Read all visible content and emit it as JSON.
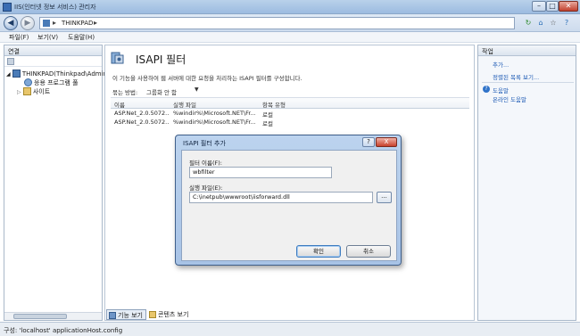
{
  "window": {
    "title": "IIS(인터넷 정보 서비스) 관리자"
  },
  "address": {
    "crumb": "THINKPAD",
    "sep1": "▸",
    "sep2": "▸"
  },
  "menu": {
    "file": "파일(F)",
    "view": "보기(V)",
    "help": "도움말(H)"
  },
  "connections": {
    "header": "연결",
    "tree": [
      {
        "label": "THINKPAD(Thinkpad\\Admin"
      },
      {
        "label": "응용 프로그램 풀"
      },
      {
        "label": "사이트"
      }
    ]
  },
  "main": {
    "title": "ISAPI 필터",
    "description": "이 기능을 사용하여 웹 서버에 대한 요청을 처리하는 ISAPI 필터를 구성합니다.",
    "group_by_label": "묶는 방법:",
    "group_by_value": "그룹화 안 함",
    "columns": [
      "이름",
      "실행 파일",
      "항목 유형"
    ],
    "rows": [
      [
        "ASP.Net_2.0.5072...",
        "%windir%\\Microsoft.NET\\Fr...",
        "로컬"
      ],
      [
        "ASP.Net_2.0.5072...",
        "%windir%\\Microsoft.NET\\Fr...",
        "로컬"
      ]
    ]
  },
  "bottom_tabs": {
    "features": "기능 보기",
    "content": "콘텐츠 보기"
  },
  "actions": {
    "header": "작업",
    "add": "추가...",
    "sort": "정렬된 목록 보기...",
    "help": "도움말",
    "online_help": "온라인 도움말"
  },
  "status": {
    "text": "구성: 'localhost' applicationHost.config"
  },
  "dialog": {
    "title": "ISAPI 필터 추가",
    "help_button": "?",
    "close_button": "X",
    "filter_name_label": "필터 이름(F):",
    "filter_name_value": "wbfilter",
    "executable_label": "실행 파일(E):",
    "executable_value": "C:\\inetpub\\wwwroot\\iisforward.dll",
    "browse_button": "...",
    "ok_button": "확인",
    "cancel_button": "취소"
  }
}
